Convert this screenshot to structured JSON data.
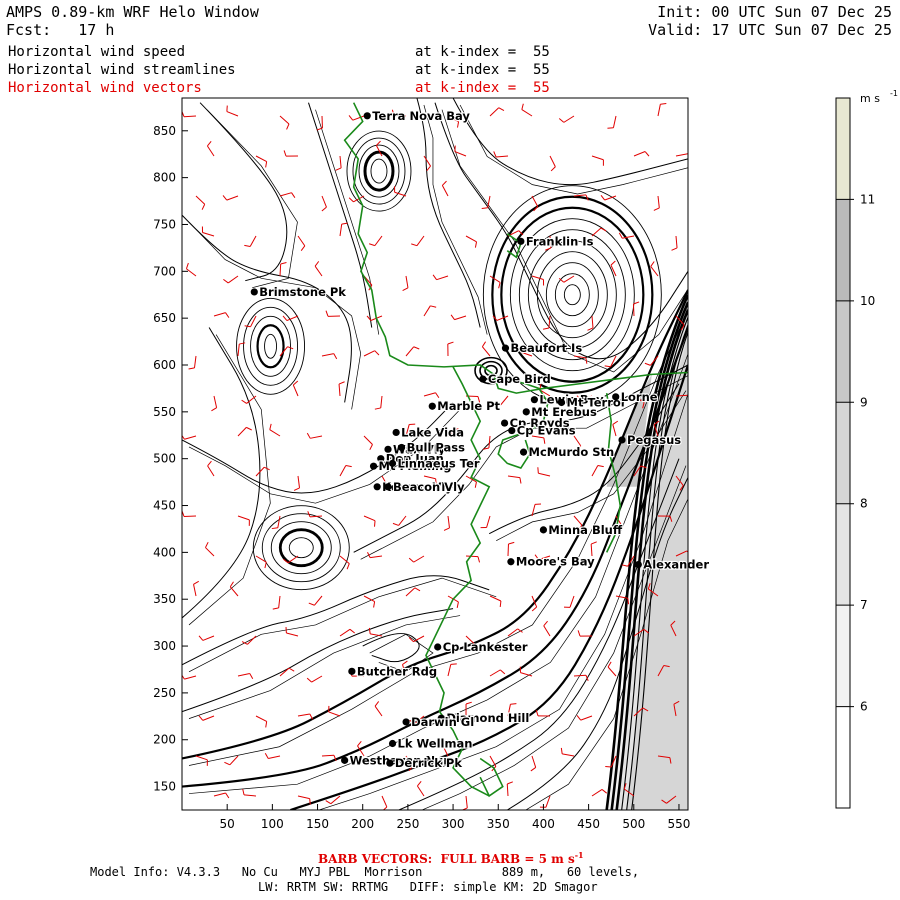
{
  "header": {
    "title": "AMPS 0.89-km WRF Helo Window",
    "fcst_label": "Fcst:",
    "fcst_value": "17 h",
    "init": "Init: 00 UTC Sun 07 Dec 25",
    "valid": "Valid: 17 UTC Sun 07 Dec 25"
  },
  "fields": [
    {
      "name": "Horizontal wind speed",
      "level": "at k-index =  55",
      "color": "#000000"
    },
    {
      "name": "Horizontal wind streamlines",
      "level": "at k-index =  55",
      "color": "#000000"
    },
    {
      "name": "Horizontal wind vectors",
      "level": "at k-index =  55",
      "color": "#e00000"
    }
  ],
  "axes": {
    "x_ticks": [
      "50",
      "100",
      "150",
      "200",
      "250",
      "300",
      "350",
      "400",
      "450",
      "500",
      "550"
    ],
    "y_ticks": [
      "150",
      "200",
      "250",
      "300",
      "350",
      "400",
      "450",
      "500",
      "550",
      "600",
      "650",
      "700",
      "750",
      "800",
      "850"
    ],
    "xlim": [
      0,
      560
    ],
    "ylim": [
      125,
      885
    ]
  },
  "colorbar": {
    "unit": "m s",
    "unit_exp": "-1",
    "ticks": [
      "6",
      "7",
      "8",
      "9",
      "10",
      "11"
    ],
    "colors": [
      "#ffffff",
      "#f2f2f2",
      "#e4e4e4",
      "#d6d6d6",
      "#c8c8c8",
      "#bababa",
      "#e8e8d2"
    ]
  },
  "places": [
    {
      "name": "Terra Nova Bay",
      "x": 205,
      "y": 866
    },
    {
      "name": "Franklin Is",
      "x": 375,
      "y": 732
    },
    {
      "name": "Brimstone Pk",
      "x": 80,
      "y": 678
    },
    {
      "name": "Beaufort Is",
      "x": 358,
      "y": 618
    },
    {
      "name": "Cape Bird",
      "x": 333,
      "y": 585
    },
    {
      "name": "Lewis Bay",
      "x": 390,
      "y": 563
    },
    {
      "name": "Mt Terror",
      "x": 420,
      "y": 560
    },
    {
      "name": "Lorne",
      "x": 480,
      "y": 566
    },
    {
      "name": "Marble Pt",
      "x": 277,
      "y": 556
    },
    {
      "name": "Mt Erebus",
      "x": 381,
      "y": 550
    },
    {
      "name": "Cp Royds",
      "x": 357,
      "y": 538
    },
    {
      "name": "Cp Evans",
      "x": 365,
      "y": 530
    },
    {
      "name": "Lake Vida",
      "x": 237,
      "y": 528
    },
    {
      "name": "Wall Vly",
      "x": 228,
      "y": 510
    },
    {
      "name": "Bull Pass",
      "x": 243,
      "y": 512
    },
    {
      "name": "Pegasus",
      "x": 487,
      "y": 520
    },
    {
      "name": "McMurdo Stn",
      "x": 378,
      "y": 507
    },
    {
      "name": "Don Juan",
      "x": 220,
      "y": 500
    },
    {
      "name": "Mt Fleming",
      "x": 212,
      "y": 492
    },
    {
      "name": "Linnaeus Ter",
      "x": 233,
      "y": 495
    },
    {
      "name": "Kennar Vly",
      "x": 216,
      "y": 470
    },
    {
      "name": "Beacon Vly",
      "x": 228,
      "y": 470
    },
    {
      "name": "Minna Bluff",
      "x": 400,
      "y": 424
    },
    {
      "name": "Moore's Bay",
      "x": 364,
      "y": 390
    },
    {
      "name": "Alexander",
      "x": 505,
      "y": 387
    },
    {
      "name": "Cp Lankester",
      "x": 283,
      "y": 299
    },
    {
      "name": "Butcher Rdg",
      "x": 188,
      "y": 273
    },
    {
      "name": "Diamond Hill",
      "x": 287,
      "y": 223
    },
    {
      "name": "Darwin Gl",
      "x": 248,
      "y": 219
    },
    {
      "name": "Lk Wellman",
      "x": 233,
      "y": 196
    },
    {
      "name": "Westhaven Nun",
      "x": 180,
      "y": 178
    },
    {
      "name": "Derrick Pk",
      "x": 230,
      "y": 175
    }
  ],
  "footer": {
    "barb_note": "BARB VECTORS:  FULL BARB = 5 m s",
    "barb_exp": "-1",
    "model_info_1": "Model Info: V4.3.3   No Cu   MYJ PBL  Morrison           889 m,   60 levels,",
    "model_info_2": "LW: RRTM SW: RRTMG   DIFF: simple KM: 2D Smagor"
  }
}
